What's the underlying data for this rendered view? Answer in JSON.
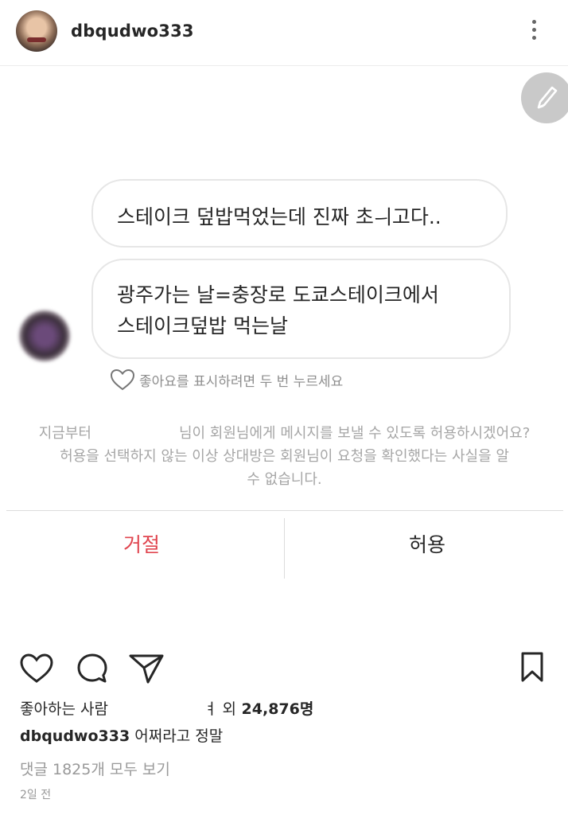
{
  "header": {
    "username": "dbqudwo333",
    "avatar_icon": "profile-photo",
    "more_icon": "more-vertical-icon"
  },
  "dm": {
    "messages": [
      "스테이크 덮밥먹었는데 진짜 초ㅢ고다..",
      "광주가는 날=충장로 도쿄스테이크에서",
      "스테이크덮밥 먹는날"
    ],
    "like_hint": "좋아요를 표시하려면 두 번 누르세요",
    "request_line1_a": "지금부터",
    "request_line1_b": "님이 회원님에게 메시지를 보낼 수 있도록 허용하시겠어요?",
    "request_line2": "허용을 선택하지 않는 이상 상대방은 회원님이 요청을 확인했다는 사실을 알",
    "request_line3": "수 없습니다.",
    "decline_label": "거절",
    "allow_label": "허용"
  },
  "post": {
    "likes_prefix": "좋아하는 사람",
    "likes_suffix_fragment": "ㅕ 외",
    "likes_count": "24,876명",
    "caption_user": "dbqudwo333",
    "caption_text": "어쩌라고 정말",
    "comments_link": "댓글 1825개 모두 보기",
    "time_ago": "2일 전"
  },
  "colors": {
    "decline": "#e0454f",
    "muted_text": "#a6a6a6",
    "edit_button": "#c9c9c9"
  }
}
